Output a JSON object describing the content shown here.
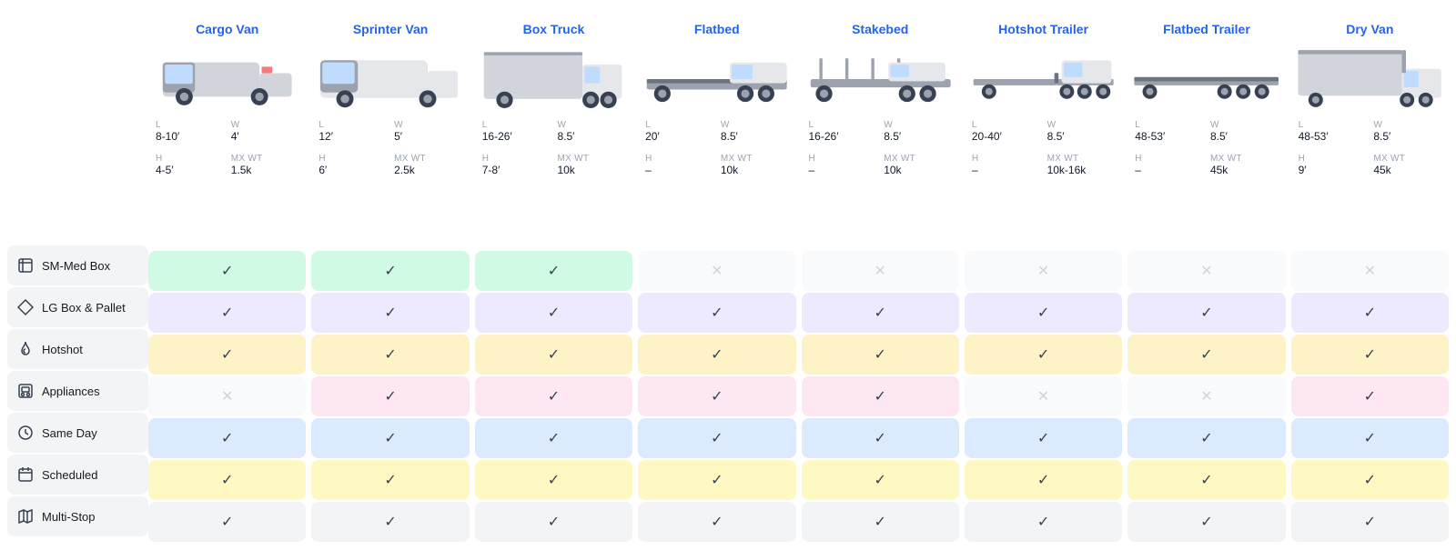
{
  "sidebar": {
    "items": [
      {
        "id": "sm-med-box",
        "label": "SM-Med Box",
        "icon": "box"
      },
      {
        "id": "lg-box-pallet",
        "label": "LG Box & Pallet",
        "icon": "diamond"
      },
      {
        "id": "hotshot",
        "label": "Hotshot",
        "icon": "flame"
      },
      {
        "id": "appliances",
        "label": "Appliances",
        "icon": "appliance"
      },
      {
        "id": "same-day",
        "label": "Same Day",
        "icon": "clock"
      },
      {
        "id": "scheduled",
        "label": "Scheduled",
        "icon": "calendar"
      },
      {
        "id": "multi-stop",
        "label": "Multi-Stop",
        "icon": "map"
      }
    ]
  },
  "vehicles": [
    {
      "id": "cargo-van",
      "title": "Cargo Van",
      "specs": {
        "L": "8-10′",
        "W": "4′",
        "H": "4-5′",
        "MX_WT": "1.5k"
      },
      "cells": [
        true,
        true,
        true,
        false,
        true,
        true,
        true
      ]
    },
    {
      "id": "sprinter-van",
      "title": "Sprinter Van",
      "specs": {
        "L": "12′",
        "W": "5′",
        "H": "6′",
        "MX_WT": "2.5k"
      },
      "cells": [
        true,
        true,
        true,
        true,
        true,
        true,
        true
      ]
    },
    {
      "id": "box-truck",
      "title": "Box Truck",
      "specs": {
        "L": "16-26′",
        "W": "8.5′",
        "H": "7-8′",
        "MX_WT": "10k"
      },
      "cells": [
        true,
        true,
        true,
        true,
        true,
        true,
        true
      ]
    },
    {
      "id": "flatbed",
      "title": "Flatbed",
      "specs": {
        "L": "20′",
        "W": "8.5′",
        "H": "–",
        "MX_WT": "10k"
      },
      "cells": [
        false,
        true,
        true,
        true,
        true,
        true,
        true
      ]
    },
    {
      "id": "stakebed",
      "title": "Stakebed",
      "specs": {
        "L": "16-26′",
        "W": "8.5′",
        "H": "–",
        "MX_WT": "10k"
      },
      "cells": [
        false,
        true,
        true,
        true,
        true,
        true,
        true
      ]
    },
    {
      "id": "hotshot-trailer",
      "title": "Hotshot Trailer",
      "specs": {
        "L": "20-40′",
        "W": "8.5′",
        "H": "–",
        "MX_WT": "10k-16k"
      },
      "cells": [
        false,
        true,
        true,
        false,
        true,
        true,
        true
      ]
    },
    {
      "id": "flatbed-trailer",
      "title": "Flatbed Trailer",
      "specs": {
        "L": "48-53′",
        "W": "8.5′",
        "H": "–",
        "MX_WT": "45k"
      },
      "cells": [
        false,
        true,
        true,
        false,
        true,
        true,
        true
      ]
    },
    {
      "id": "dry-van",
      "title": "Dry Van",
      "specs": {
        "L": "48-53′",
        "W": "8.5′",
        "H": "9′",
        "MX_WT": "45k"
      },
      "cells": [
        false,
        true,
        true,
        true,
        true,
        true,
        true
      ]
    }
  ],
  "row_colors": [
    "#d1fae5",
    "#ede9fe",
    "#fef3c7",
    "#fce7f3",
    "#dbeafe",
    "#fef9c3",
    "#f3f4f6"
  ],
  "labels": {
    "L": "L",
    "W": "W",
    "H": "H",
    "MX_WT": "MX WT"
  }
}
